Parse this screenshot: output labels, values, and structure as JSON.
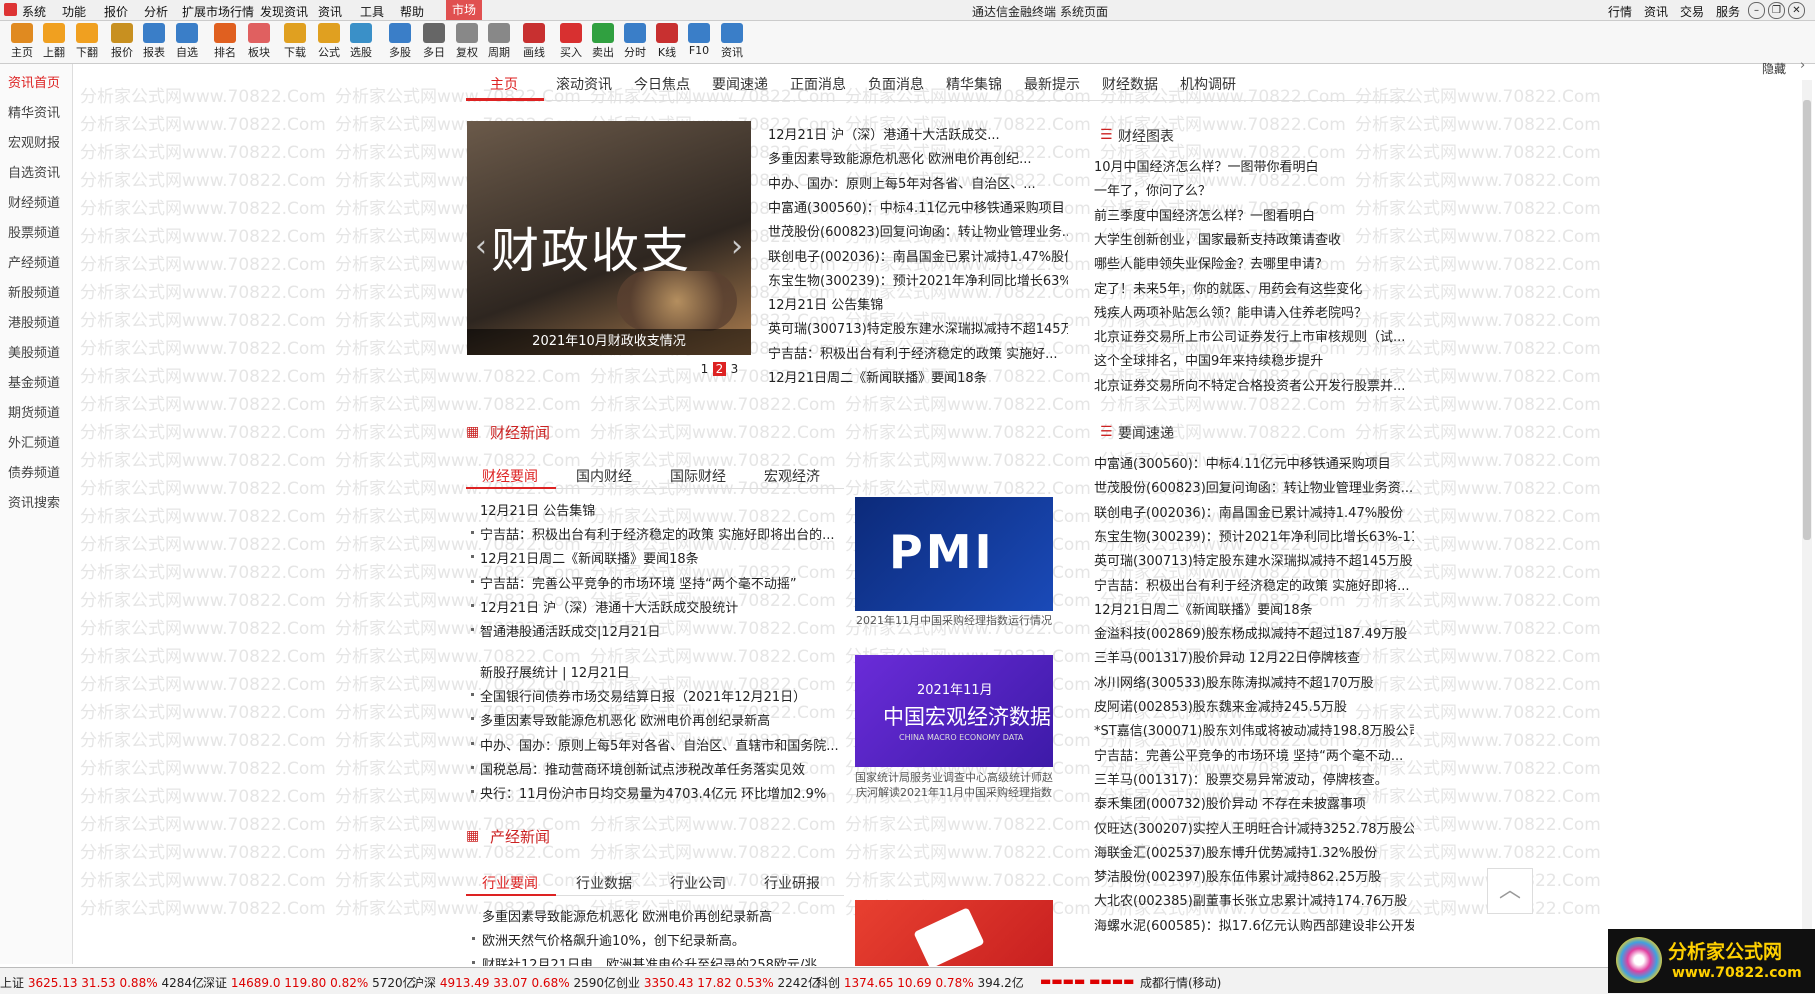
{
  "menubar": {
    "items": [
      "系统",
      "功能",
      "报价",
      "分析",
      "扩展市场行情",
      "发现资讯",
      "资讯",
      "工具",
      "帮助",
      "市场"
    ],
    "title": "通达信金融终端",
    "page": "系统页面",
    "right": [
      "行情",
      "资讯",
      "交易",
      "服务"
    ]
  },
  "toolbar": {
    "buttons": [
      {
        "label": "主页",
        "icon": "home-icon",
        "color": "#e08a20"
      },
      {
        "label": "上翻",
        "icon": "page-up-icon",
        "color": "#f0a020"
      },
      {
        "label": "下翻",
        "icon": "page-down-icon",
        "color": "#f0a020"
      },
      {
        "label": "报价",
        "icon": "quote-icon",
        "color": "#c89020"
      },
      {
        "label": "报表",
        "icon": "report-icon",
        "color": "#3a7ec8"
      },
      {
        "label": "自选",
        "icon": "favorites-icon",
        "color": "#3a7ec8"
      },
      {
        "label": "排名",
        "icon": "ranking-icon",
        "color": "#e06020"
      },
      {
        "label": "板块",
        "icon": "sector-icon",
        "color": "#e06060"
      },
      {
        "label": "下载",
        "icon": "download-icon",
        "color": "#e0a020"
      },
      {
        "label": "公式",
        "icon": "formula-icon",
        "color": "#e0a020"
      },
      {
        "label": "选股",
        "icon": "stock-pick-icon",
        "color": "#3a90c8"
      },
      {
        "label": "多股",
        "icon": "multi-stock-icon",
        "color": "#3a7ec8"
      },
      {
        "label": "多日",
        "icon": "multi-day-icon",
        "color": "#666666"
      },
      {
        "label": "复权",
        "icon": "adjust-icon",
        "color": "#888888"
      },
      {
        "label": "周期",
        "icon": "period-icon",
        "color": "#888888"
      },
      {
        "label": "画线",
        "icon": "draw-line-icon",
        "color": "#c83030"
      },
      {
        "label": "买入",
        "icon": "buy-icon",
        "color": "#d83030"
      },
      {
        "label": "卖出",
        "icon": "sell-icon",
        "color": "#30a040"
      },
      {
        "label": "分时",
        "icon": "intraday-icon",
        "color": "#3a7ec8"
      },
      {
        "label": "K线",
        "icon": "kline-icon",
        "color": "#c83030"
      },
      {
        "label": "F10",
        "icon": "f10-icon",
        "color": "#3a7ec8"
      },
      {
        "label": "资讯",
        "icon": "info-icon",
        "color": "#3a7ec8"
      }
    ]
  },
  "sidebar": {
    "items": [
      "资讯首页",
      "精华资讯",
      "宏观财报",
      "自选资讯",
      "财经频道",
      "股票频道",
      "产经频道",
      "新股频道",
      "港股频道",
      "美股频道",
      "基金频道",
      "期货频道",
      "外汇频道",
      "债券频道",
      "资讯搜索"
    ]
  },
  "nav": {
    "tabs": [
      "主页",
      "滚动资讯",
      "今日焦点",
      "要闻速递",
      "正面消息",
      "负面消息",
      "精华集锦",
      "最新提示",
      "财经数据",
      "机构调研"
    ],
    "collapse": "隐藏"
  },
  "hero": {
    "image_text": "财政收支",
    "caption": "2021年10月财政收支情况",
    "pages": [
      "1",
      "2",
      "3"
    ]
  },
  "headlines": [
    "12月21日 沪（深）港通十大活跃成交...",
    "多重因素导致能源危机恶化 欧洲电价再创纪...",
    "中办、国办：原则上每5年对各省、自治区、...",
    "中富通(300560)：中标4.11亿元中移铁通采购项目",
    "世茂股份(600823)回复问询函：转让物业管理业务...",
    "联创电子(002036)：南昌国金已累计减持1.47%股份",
    "东宝生物(300239)：预计2021年净利同比增长63%...",
    "12月21日 公告集锦",
    "英可瑞(300713)特定股东建水深瑞拟减持不超145万...",
    "宁吉喆：积极出台有利于经济稳定的政策 实施好...",
    "12月21日周二《新闻联播》要闻18条"
  ],
  "finance_news": {
    "title": "财经新闻",
    "tabs": [
      "财经要闻",
      "国内财经",
      "国际财经",
      "宏观经济"
    ],
    "group1_head": "12月21日 公告集锦",
    "group1": [
      "宁吉喆：积极出台有利于经济稳定的政策 实施好即将出台的...",
      "12月21日周二《新闻联播》要闻18条",
      "宁吉喆：完善公平竞争的市场环境 坚持“两个毫不动摇”",
      "12月21日 沪（深）港通十大活跃成交股统计",
      "智通港股通活跃成交|12月21日"
    ],
    "group2_head": "新股孖展统计 | 12月21日",
    "group2": [
      "全国银行间债券市场交易结算日报（2021年12月21日）",
      "多重因素导致能源危机恶化 欧洲电价再创纪录新高",
      "中办、国办：原则上每5年对各省、自治区、直辖市和国务院...",
      "国税总局：推动营商环境创新试点涉税改革任务落实见效",
      "央行：11月份沪市日均交易量为4703.4亿元 环比增加2.9%"
    ],
    "thumb1_text": "PMI",
    "thumb1_caption": "2021年11月中国采购经理指数运行情况",
    "thumb2_title1": "2021年11月",
    "thumb2_title2": "中国宏观经济数据",
    "thumb2_sub": "CHINA MACRO ECONOMY DATA",
    "thumb2_caption": "国家统计局服务业调查中心高级统计师赵庆河解读2021年11月中国采购经理指数"
  },
  "industry_news": {
    "title": "产经新闻",
    "tabs": [
      "行业要闻",
      "行业数据",
      "行业公司",
      "行业研报"
    ],
    "head": "多重因素导致能源危机恶化 欧洲电价再创纪录新高",
    "items": [
      "欧洲天然气价格飙升逾10%，创下纪录新高。",
      "财联社12月21日电，欧洲基准电价升至纪录的258欧元/兆..."
    ]
  },
  "finance_charts": {
    "title": "财经图表",
    "items": [
      "10月中国经济怎么样？一图带你看明白",
      "一年了，你问了么？",
      "前三季度中国经济怎么样？一图看明白",
      "大学生创新创业，国家最新支持政策请查收",
      "哪些人能申领失业保险金？去哪里申请?",
      "定了！未来5年，你的就医、用药会有这些变化",
      "残疾人两项补贴怎么领？能申请入住养老院吗？",
      "北京证券交易所上市公司证券发行上市审核规则（试...",
      "这个全球排名，中国9年来持续稳步提升",
      "北京证券交易所向不特定合格投资者公开发行股票并..."
    ]
  },
  "quick_news": {
    "title": "要闻速递",
    "items": [
      "中富通(300560)：中标4.11亿元中移铁通采购项目",
      "世茂股份(600823)回复问询函：转让物业管理业务资...",
      "联创电子(002036)：南昌国金已累计减持1.47%股份",
      "东宝生物(300239)：预计2021年净利同比增长63%-11...",
      "英可瑞(300713)特定股东建水深瑞拟减持不超145万股",
      "宁吉喆：积极出台有利于经济稳定的政策 实施好即将...",
      "12月21日周二《新闻联播》要闻18条",
      "金溢科技(002869)股东杨成拟减持不超过187.49万股",
      "三羊马(001317)股价异动 12月22日停牌核查",
      "冰川网络(300533)股东陈涛拟减持不超170万股",
      "皮阿诺(002853)股东魏来金减持245.5万股",
      "*ST嘉信(300071)股东刘伟或将被动减持198.8万股公司...",
      "宁吉喆：完善公平竞争的市场环境 坚持“两个毫不动...",
      "三羊马(001317)：股票交易异常波动，停牌核查。",
      "泰禾集团(000732)股价异动 不存在未披露事项",
      "仅旺达(300207)实控人王明旺合计减持3252.78万股公...",
      "海联金汇(002537)股东博升优势减持1.32%股份",
      "梦洁股份(002397)股东伍伟累计减持862.25万股",
      "大北农(002385)副董事长张立忠累计减持174.76万股",
      "海螺水泥(600585)：拟17.6亿元认购西部建设非公开发..."
    ]
  },
  "statusbar": {
    "items": [
      {
        "name": "上证",
        "value": "3625.13",
        "chg": "31.53",
        "pct": "0.88%",
        "amt": "4284亿"
      },
      {
        "name": "深证",
        "value": "14689.0",
        "chg": "119.80",
        "pct": "0.82%",
        "amt": "5720亿"
      },
      {
        "name": "沪深",
        "value": "4913.49",
        "chg": "33.07",
        "pct": "0.68%",
        "amt": "2590亿"
      },
      {
        "name": "创业",
        "value": "3350.43",
        "chg": "17.82",
        "pct": "0.53%",
        "amt": "2242亿"
      },
      {
        "name": "科创",
        "value": "1374.65",
        "chg": "10.69",
        "pct": "0.78%",
        "amt": "394.2亿"
      }
    ],
    "server": "成都行情(移动)"
  },
  "logo": {
    "line1": "分析家公式网",
    "line2": "www.70822.com"
  },
  "watermark": "分析家公式网www.70822.Com",
  "colors": {
    "accent": "#dd2222",
    "brand_logo": "#ffd000"
  }
}
